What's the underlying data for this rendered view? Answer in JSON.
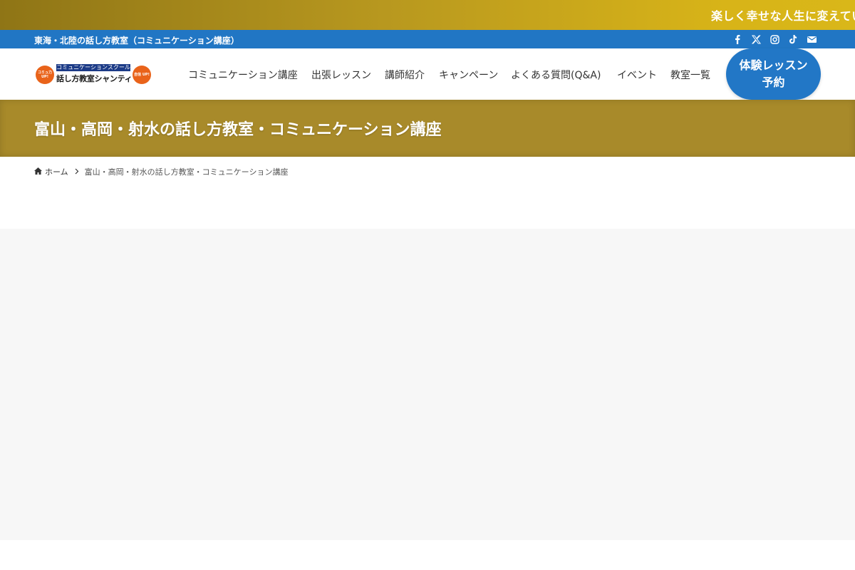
{
  "marquee": {
    "text": "楽しく幸せな人生に変えてい"
  },
  "infobar": {
    "tagline": "東海・北陸の話し方教室（コミュニケーション講座）",
    "social_icons": [
      "facebook-icon",
      "x-icon",
      "instagram-icon",
      "tiktok-icon",
      "mail-icon"
    ]
  },
  "logo": {
    "left_badge": "コミュ力 UP!",
    "tag": "コミュニケーションスクール",
    "name": "話し方教室シャンティ",
    "right_badge": "自信 UP!"
  },
  "nav": {
    "items": [
      "コミュニケーション講座",
      "出張レッスン",
      "講師紹介",
      "キャンペーン",
      "よくある質問(Q&A)",
      "イベント",
      "教室一覧"
    ],
    "cta": "体験レッスン予約"
  },
  "banner": {
    "title": "富山・高岡・射水の話し方教室・コミュニケーション講座"
  },
  "breadcrumb": {
    "home": "ホーム",
    "current": "富山・高岡・射水の話し方教室・コミュニケーション講座"
  },
  "colors": {
    "marquee_gold": "#c7a51c",
    "info_blue": "#2176c4",
    "banner_gold": "#a88a2a",
    "cta_blue": "#2277c6",
    "logo_orange": "#e9631a",
    "logo_navy": "#1c3b87"
  }
}
